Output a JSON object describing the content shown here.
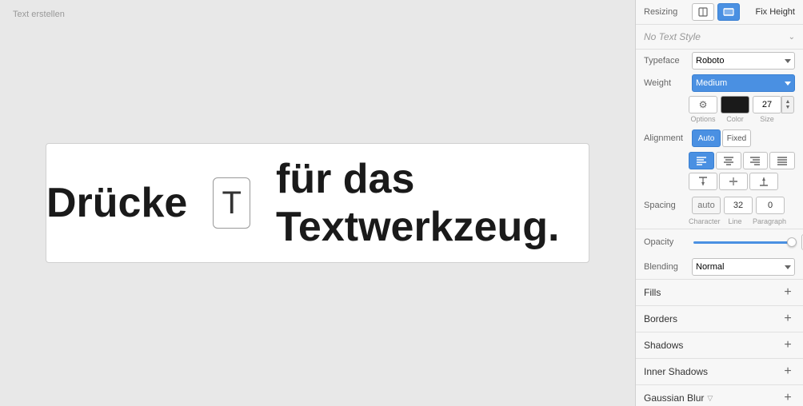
{
  "canvas": {
    "label": "Text erstellen",
    "card": {
      "text_left": "Drücke",
      "t_box": "T",
      "text_right": "für das Textwerkzeug."
    }
  },
  "panel": {
    "resizing": {
      "label": "Resizing",
      "fix_height": "Fix Height"
    },
    "text_style": {
      "label": "No Text Style",
      "placeholder": "No Text Style"
    },
    "typeface": {
      "label": "Typeface",
      "value": "Roboto"
    },
    "weight": {
      "label": "Weight",
      "value": "Medium"
    },
    "options": {
      "options_label": "Options",
      "color_label": "Color",
      "size_value": "27",
      "size_label": "Size"
    },
    "alignment": {
      "label": "Alignment",
      "auto": "Auto",
      "fixed": "Fixed"
    },
    "text_align": {
      "left": "≡",
      "center": "≡",
      "right": "≡",
      "justify": "≡"
    },
    "vert_align": {
      "top": "↑",
      "middle": "↕",
      "bottom": "↓"
    },
    "spacing": {
      "label": "Spacing",
      "character_placeholder": "auto",
      "line_value": "32",
      "paragraph_value": "0",
      "character_label": "Character",
      "line_label": "Line",
      "paragraph_label": "Paragraph"
    },
    "opacity": {
      "label": "Opacity",
      "value": "100 %",
      "percent": 100
    },
    "blending": {
      "label": "Blending",
      "value": "Normal"
    },
    "fills": {
      "label": "Fills"
    },
    "borders": {
      "label": "Borders"
    },
    "shadows": {
      "label": "Shadows"
    },
    "inner_shadows": {
      "label": "Inner Shadows"
    },
    "gaussian_blur": {
      "label": "Gaussian Blur"
    }
  }
}
